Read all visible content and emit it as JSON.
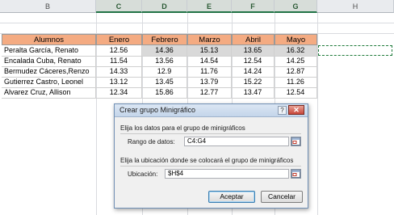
{
  "columns": [
    {
      "id": "B",
      "label": "B",
      "selected": false
    },
    {
      "id": "C",
      "label": "C",
      "selected": true
    },
    {
      "id": "D",
      "label": "D",
      "selected": true
    },
    {
      "id": "E",
      "label": "E",
      "selected": true
    },
    {
      "id": "F",
      "label": "F",
      "selected": true
    },
    {
      "id": "G",
      "label": "G",
      "selected": true
    },
    {
      "id": "H",
      "label": "H",
      "selected": false
    }
  ],
  "table": {
    "headers": [
      "Alumnos",
      "Enero",
      "Febrero",
      "Marzo",
      "Abril",
      "Mayo"
    ],
    "rows": [
      {
        "name": "Peralta García, Renato",
        "values": [
          "12.56",
          "14.36",
          "15.13",
          "13.65",
          "16.32"
        ]
      },
      {
        "name": "Encalada Cuba, Renato",
        "values": [
          "11.54",
          "13.56",
          "14.54",
          "12.54",
          "14.25"
        ]
      },
      {
        "name": "Bermudez Cáceres,Renzo",
        "values": [
          "14.33",
          "12.9",
          "11.76",
          "14.24",
          "12.87"
        ]
      },
      {
        "name": "Gutierrez Castro, Leonel",
        "values": [
          "13.12",
          "13.45",
          "13.79",
          "15.22",
          "11.26"
        ]
      },
      {
        "name": "Alvarez Cruz, Allison",
        "values": [
          "12.34",
          "15.86",
          "12.77",
          "13.47",
          "12.54"
        ]
      }
    ]
  },
  "dialog": {
    "title": "Crear grupo Minigráfico",
    "help_glyph": "?",
    "close_glyph": "✕",
    "data_section_label": "Elija los datos para el grupo de minigráficos",
    "range_label": "Rango de datos:",
    "range_value": "C4:G4",
    "location_section_label": "Elija la ubicación donde se colocará el grupo de minigráficos",
    "location_label": "Ubicación:",
    "location_value": "$H$4",
    "ok_label": "Aceptar",
    "cancel_label": "Cancelar"
  }
}
